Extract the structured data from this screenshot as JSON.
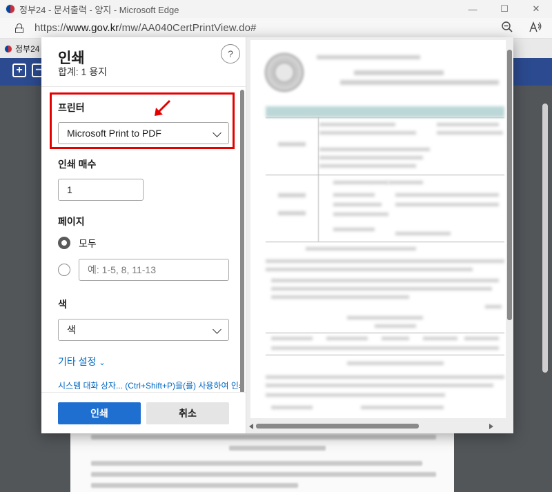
{
  "window": {
    "title": "정부24 - 문서출력 - 양지 - Microsoft Edge",
    "minimize_glyph": "—",
    "maximize_glyph": "☐",
    "close_glyph": "✕"
  },
  "address": {
    "url_prefix": "https://",
    "url_host": "www.gov.kr",
    "url_path": "/mw/AA040CertPrintView.do#",
    "zoom_icon": "zoom-out-icon",
    "read_aloud_icon": "read-aloud-icon"
  },
  "tab": {
    "label": "정부24"
  },
  "print_dialog": {
    "title": "인쇄",
    "subtitle": "합계: 1 용지",
    "help_label": "?",
    "printer": {
      "label": "프린터",
      "selected": "Microsoft Print to PDF"
    },
    "copies": {
      "label": "인쇄 매수",
      "value": "1"
    },
    "pages": {
      "label": "페이지",
      "all_label": "모두",
      "custom_placeholder": "예: 1-5, 8, 11-13",
      "selected": "all"
    },
    "color": {
      "label": "색",
      "selected": "색"
    },
    "more_settings": "기타 설정",
    "system_dialog": "시스템 대화 상자... (Ctrl+Shift+P)을(를) 사용하여 인쇄",
    "print_button": "인쇄",
    "cancel_button": "취소"
  },
  "annotation": {
    "highlight_color": "#e50000"
  },
  "colors": {
    "accent": "#1f6fd0",
    "link": "#0067c0",
    "site_toolbar": "#2b4a8f"
  }
}
